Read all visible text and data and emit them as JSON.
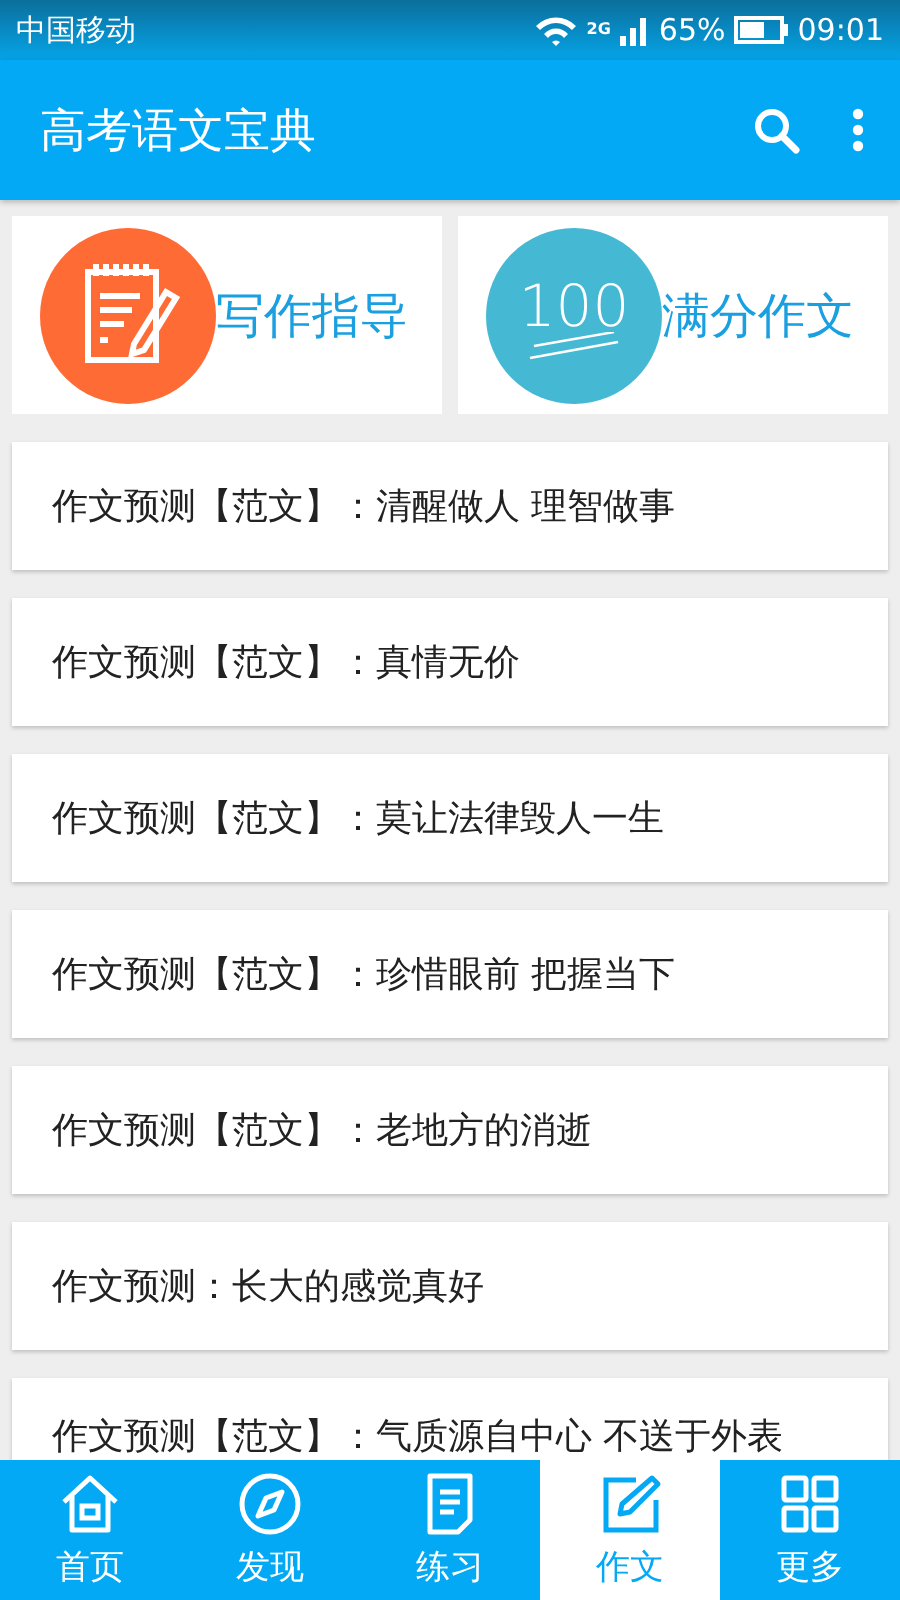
{
  "status_bar": {
    "carrier": "中国移动",
    "network": "2G",
    "battery": "65%",
    "time": "09:01"
  },
  "app_bar": {
    "title": "高考语文宝典"
  },
  "features": [
    {
      "kind": "notepad",
      "label": "写作指导"
    },
    {
      "kind": "score",
      "label": "满分作文",
      "badge": "100"
    }
  ],
  "articles": [
    {
      "title": "作文预测【范文】：清醒做人 理智做事"
    },
    {
      "title": "作文预测【范文】：真情无价"
    },
    {
      "title": "作文预测【范文】：莫让法律毁人一生"
    },
    {
      "title": "作文预测【范文】：珍惜眼前 把握当下"
    },
    {
      "title": "作文预测【范文】：老地方的消逝"
    },
    {
      "title": "作文预测：长大的感觉真好"
    },
    {
      "title": "作文预测【范文】：气质源自中心 不送于外表"
    }
  ],
  "bottom_nav": [
    {
      "kind": "home",
      "label": "首页",
      "selected": false
    },
    {
      "kind": "discover",
      "label": "发现",
      "selected": false
    },
    {
      "kind": "practice",
      "label": "练习",
      "selected": false
    },
    {
      "kind": "essay",
      "label": "作文",
      "selected": true
    },
    {
      "kind": "more",
      "label": "更多",
      "selected": false
    }
  ]
}
